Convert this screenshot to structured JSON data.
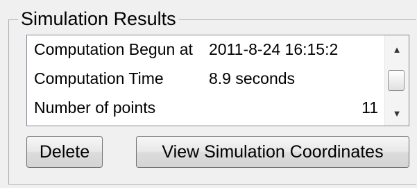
{
  "group": {
    "title": "Simulation Results"
  },
  "results": [
    {
      "label": "Computation Begun at",
      "value": "2011-8-24 16:15:2",
      "align": "left"
    },
    {
      "label": "Computation Time",
      "value": "8.9  seconds",
      "align": "left"
    },
    {
      "label": "Number of points",
      "value": "11",
      "align": "right"
    }
  ],
  "scrollbar": {
    "up_icon": "▲",
    "down_icon": "▼"
  },
  "buttons": {
    "delete_label": "Delete",
    "view_coordinates_label": "View Simulation Coordinates"
  }
}
